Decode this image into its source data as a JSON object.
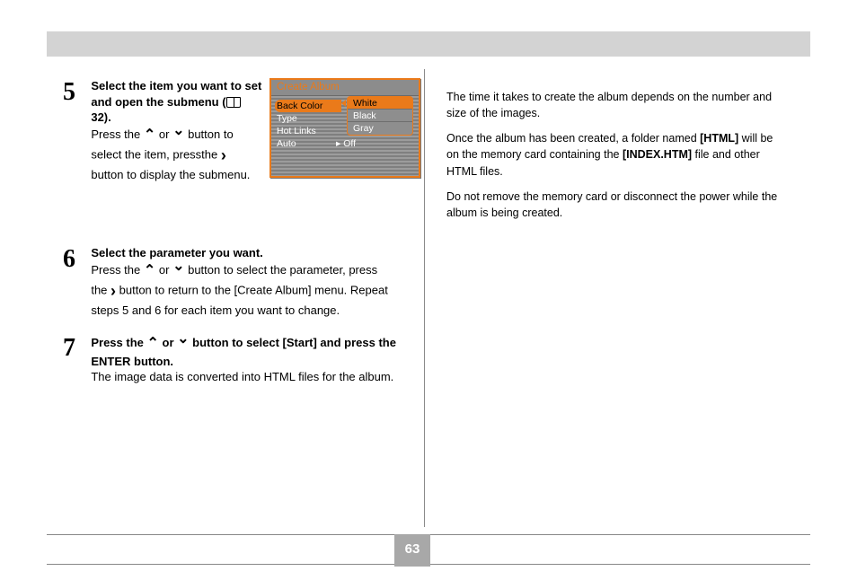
{
  "page_number": "63",
  "step5": {
    "num": "5",
    "line1_a": "Select the item you want to set and open the submenu (",
    "line1_b": " 32).",
    "line2_a": "Press the ",
    "line2_c": " or ",
    "line2_e": " button to select the item, pressthe ",
    "line2_g": " button to display the submenu."
  },
  "step6": {
    "num": "6",
    "line1": "Select the parameter you want.",
    "line2_a": "Press the ",
    "line2_c": " or ",
    "line2_e": " button to select the parameter, press the ",
    "line2_g": " button to return to the [Create Album] menu. Repeat steps 5 and 6 for each item you want to change."
  },
  "step7": {
    "num": "7",
    "line1_a": "Press the ",
    "line1_c": " or ",
    "line1_e": " button to select [Start] and press the ENTER button.",
    "line2": "The image data is converted into HTML files for the album."
  },
  "right": {
    "p1": "The time it takes to create the album depends on the number and size of the images.",
    "p2_a": "Once the album has been created, a folder named ",
    "p2_b": "[HTML]",
    "p2_c": " will be on the memory card containing the ",
    "p2_d": "[INDEX.HTM]",
    "p2_e": " file and other HTML files.",
    "p3": "Do not remove the memory card or disconnect the power while the album is being created."
  },
  "lcd": {
    "title": "Create Album",
    "items": [
      {
        "label": "Back Color"
      },
      {
        "label": "Type"
      },
      {
        "label": "Hot Links"
      },
      {
        "label": "Auto",
        "value": "Off"
      }
    ],
    "popup": [
      "White",
      "Black",
      "Gray"
    ]
  }
}
